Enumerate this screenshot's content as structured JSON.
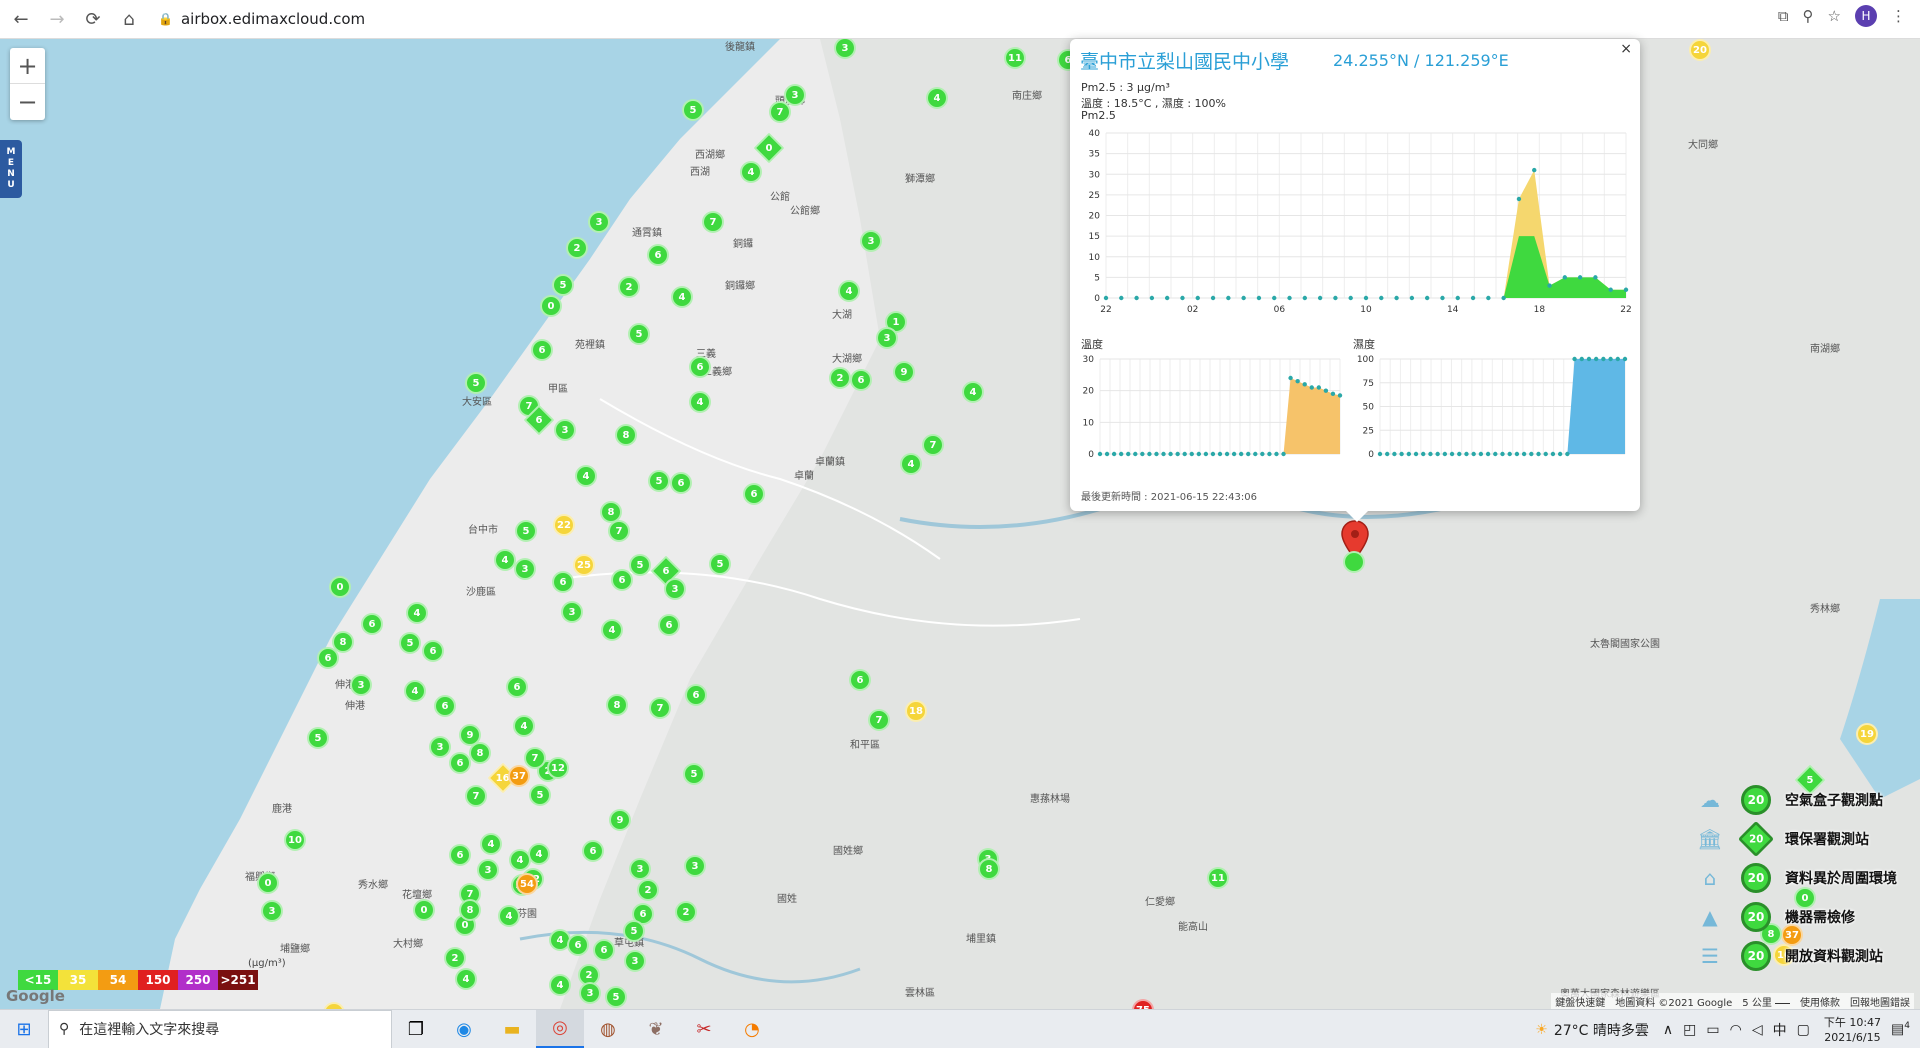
{
  "browser": {
    "url": "airbox.edimaxcloud.com",
    "profile_initial": "H"
  },
  "map": {
    "zoom_in": "+",
    "zoom_out": "−",
    "menu_label": [
      "M",
      "E",
      "N",
      "U"
    ],
    "place_names": [
      {
        "t": "後龍鎮"
      },
      {
        "t": "頭屋鄉"
      },
      {
        "t": "南庄鄉"
      },
      {
        "t": "西湖鄉"
      },
      {
        "t": "西湖"
      },
      {
        "t": "獅潭鄉"
      },
      {
        "t": "公館"
      },
      {
        "t": "公館鄉"
      },
      {
        "t": "通霄鎮"
      },
      {
        "t": "銅鑼"
      },
      {
        "t": "銅鑼鄉"
      },
      {
        "t": "大湖"
      },
      {
        "t": "大湖鄉"
      },
      {
        "t": "苑裡鎮"
      },
      {
        "t": "三義"
      },
      {
        "t": "三義鄉"
      },
      {
        "t": "大安區"
      },
      {
        "t": "甲區"
      },
      {
        "t": "卓蘭鎮"
      },
      {
        "t": "卓蘭"
      },
      {
        "t": "台中市"
      },
      {
        "t": "沙鹿區"
      },
      {
        "t": "伸港鄉"
      },
      {
        "t": "伸港"
      },
      {
        "t": "和平區"
      },
      {
        "t": "鹿港"
      },
      {
        "t": "福興鄉"
      },
      {
        "t": "秀水鄉"
      },
      {
        "t": "花壇鄉"
      },
      {
        "t": "芬園"
      },
      {
        "t": "國姓鄉"
      },
      {
        "t": "國姓"
      },
      {
        "t": "埔里鎮"
      },
      {
        "t": "草屯鎮"
      },
      {
        "t": "大村鄉"
      },
      {
        "t": "埔鹽鄉"
      },
      {
        "t": "惠蓀林場"
      },
      {
        "t": "仁愛鄉"
      },
      {
        "t": "能高山"
      },
      {
        "t": "南湖鄉"
      },
      {
        "t": "大同鄉"
      },
      {
        "t": "秀林鄉"
      },
      {
        "t": "太魯閣國家公園"
      },
      {
        "t": "奧萬大國家森林遊樂區"
      },
      {
        "t": "雲林區"
      }
    ],
    "markers_cluster_color": "#3fd93f",
    "markers": [
      {
        "v": "3"
      },
      {
        "v": "11"
      },
      {
        "v": "7"
      },
      {
        "v": "3"
      },
      {
        "v": "4"
      },
      {
        "v": "5"
      },
      {
        "v": "0"
      },
      {
        "v": "4"
      },
      {
        "v": "7"
      },
      {
        "v": "3"
      },
      {
        "v": "3"
      },
      {
        "v": "2"
      },
      {
        "v": "6"
      },
      {
        "v": "5"
      },
      {
        "v": "2"
      },
      {
        "v": "4"
      },
      {
        "v": "4"
      },
      {
        "v": "1"
      },
      {
        "v": "3"
      },
      {
        "v": "5"
      },
      {
        "v": "6"
      },
      {
        "v": "0"
      },
      {
        "v": "2"
      },
      {
        "v": "6"
      },
      {
        "v": "6"
      },
      {
        "v": "5"
      },
      {
        "v": "4"
      },
      {
        "v": "7"
      },
      {
        "v": "6"
      },
      {
        "v": "3"
      },
      {
        "v": "8"
      },
      {
        "v": "5"
      },
      {
        "v": "6"
      },
      {
        "v": "4"
      },
      {
        "v": "4"
      },
      {
        "v": "7"
      },
      {
        "v": "6"
      },
      {
        "v": "4"
      },
      {
        "v": "8"
      },
      {
        "v": "5"
      },
      {
        "v": "3"
      },
      {
        "v": "6"
      },
      {
        "v": "4"
      },
      {
        "v": "3"
      },
      {
        "v": "7"
      },
      {
        "v": "5"
      },
      {
        "v": "6"
      },
      {
        "v": "5"
      },
      {
        "v": "4"
      },
      {
        "v": "3"
      },
      {
        "v": "6"
      },
      {
        "v": "0"
      },
      {
        "v": "6"
      },
      {
        "v": "8"
      },
      {
        "v": "6"
      },
      {
        "v": "3"
      },
      {
        "v": "4"
      },
      {
        "v": "5"
      },
      {
        "v": "6"
      },
      {
        "v": "4"
      },
      {
        "v": "6"
      },
      {
        "v": "9"
      },
      {
        "v": "3"
      },
      {
        "v": "6"
      },
      {
        "v": "8"
      },
      {
        "v": "4"
      },
      {
        "v": "7"
      },
      {
        "v": "2"
      },
      {
        "v": "12"
      },
      {
        "v": "4"
      },
      {
        "v": "6"
      },
      {
        "v": "3"
      },
      {
        "v": "9"
      },
      {
        "v": "5"
      },
      {
        "v": "7"
      },
      {
        "v": "6"
      },
      {
        "v": "16"
      },
      {
        "v": "37"
      },
      {
        "v": "4"
      },
      {
        "v": "6"
      },
      {
        "v": "4"
      },
      {
        "v": "3"
      },
      {
        "v": "7"
      },
      {
        "v": "0"
      },
      {
        "v": "8"
      },
      {
        "v": "0"
      },
      {
        "v": "12"
      },
      {
        "v": "6"
      },
      {
        "v": "3"
      },
      {
        "v": "5"
      },
      {
        "v": "7"
      },
      {
        "v": "6"
      },
      {
        "v": "8"
      },
      {
        "v": "13"
      },
      {
        "v": "54"
      },
      {
        "v": "4"
      },
      {
        "v": "2"
      },
      {
        "v": "2"
      },
      {
        "v": "5"
      },
      {
        "v": "3"
      },
      {
        "v": "2"
      },
      {
        "v": "4"
      },
      {
        "v": "4"
      },
      {
        "v": "6"
      },
      {
        "v": "6"
      },
      {
        "v": "2"
      },
      {
        "v": "5"
      },
      {
        "v": "4"
      },
      {
        "v": "3"
      },
      {
        "v": "18"
      },
      {
        "v": "6"
      },
      {
        "v": "7"
      },
      {
        "v": "3"
      },
      {
        "v": "11"
      },
      {
        "v": "6"
      },
      {
        "v": "9"
      },
      {
        "v": "75"
      },
      {
        "v": "17"
      },
      {
        "v": "20"
      },
      {
        "v": "19"
      },
      {
        "v": "22"
      },
      {
        "v": "25"
      },
      {
        "v": "6"
      },
      {
        "v": "5"
      },
      {
        "v": "10"
      },
      {
        "v": "0"
      },
      {
        "v": "8"
      },
      {
        "v": "3"
      },
      {
        "v": "5"
      },
      {
        "v": "0"
      },
      {
        "v": "37"
      },
      {
        "v": "16"
      },
      {
        "v": "8"
      },
      {
        "v": "15"
      },
      {
        "v": "10"
      }
    ],
    "attribution": "鍵盤快速鍵　地圖資料 ©2021 Google　5 公里 ⎯⎯⎯　使用條款　回報地圖錯誤",
    "google_logo": "Google"
  },
  "popup": {
    "title": "臺中市立梨山國民中小學",
    "coords": "24.255°N / 121.259°E",
    "pm25_line": "Pm2.5 : 3 μg/m³",
    "temp_hum_line": "溫度 : 18.5°C , 濕度 : 100%",
    "pm25_chart_label": "Pm2.5",
    "temp_label": "溫度",
    "hum_label": "濕度",
    "updated": "最後更新時間 : 2021-06-15 22:43:06",
    "close": "×"
  },
  "chart_data": [
    {
      "type": "area",
      "title": "Pm2.5",
      "x_ticks": [
        "22",
        "02",
        "06",
        "10",
        "14",
        "18",
        "22"
      ],
      "ylim": [
        0,
        40
      ],
      "y_ticks": [
        0,
        5,
        10,
        15,
        20,
        25,
        30,
        35,
        40
      ],
      "values": [
        0,
        0,
        0,
        0,
        0,
        0,
        0,
        0,
        0,
        0,
        0,
        0,
        0,
        0,
        0,
        0,
        0,
        0,
        0,
        0,
        0,
        0,
        0,
        0,
        0,
        0,
        0,
        24,
        31,
        3,
        5,
        5,
        5,
        2,
        2
      ],
      "colors": {
        "low": "#3fd93f",
        "mid": "#f5d76e"
      }
    },
    {
      "type": "area",
      "title": "溫度",
      "ylim": [
        0,
        30
      ],
      "y_ticks": [
        0,
        10,
        20,
        30
      ],
      "values": [
        0,
        0,
        0,
        0,
        0,
        0,
        0,
        0,
        0,
        0,
        0,
        0,
        0,
        0,
        0,
        0,
        0,
        0,
        0,
        0,
        0,
        0,
        0,
        0,
        0,
        0,
        0,
        24,
        23,
        22,
        21,
        21,
        20,
        19,
        18.5
      ],
      "color": "#f6c36a"
    },
    {
      "type": "area",
      "title": "濕度",
      "ylim": [
        0,
        100
      ],
      "y_ticks": [
        0,
        25,
        50,
        75,
        100
      ],
      "values": [
        0,
        0,
        0,
        0,
        0,
        0,
        0,
        0,
        0,
        0,
        0,
        0,
        0,
        0,
        0,
        0,
        0,
        0,
        0,
        0,
        0,
        0,
        0,
        0,
        0,
        0,
        0,
        100,
        100,
        100,
        100,
        100,
        100,
        100,
        100
      ],
      "color": "#5fb8e6"
    }
  ],
  "legend": [
    {
      "icon": "airbox-icon",
      "value": "20",
      "label": "空氣盒子觀測點"
    },
    {
      "icon": "epa-building-icon",
      "value": "20",
      "label": "環保署觀測站"
    },
    {
      "icon": "abnormal-house-icon",
      "value": "20",
      "label": "資料異於周圍環境"
    },
    {
      "icon": "maintenance-cone-icon",
      "value": "20",
      "label": "機器需檢修"
    },
    {
      "icon": "open-data-icon",
      "value": "20",
      "label": "開放資料觀測站"
    }
  ],
  "scale": {
    "labels": [
      "<15",
      "35",
      "54",
      "150",
      "250",
      ">251"
    ],
    "colors": [
      "#3fd93f",
      "#f3e23a",
      "#f39c12",
      "#e02020",
      "#b12ec9",
      "#7a1010"
    ],
    "unit": "(μg/m³)"
  },
  "taskbar": {
    "search_placeholder": "在這裡輸入文字來搜尋",
    "weather": "27°C  晴時多雲",
    "ime": "中",
    "time": "下午 10:47",
    "date": "2021/6/15",
    "notifications": "4"
  }
}
